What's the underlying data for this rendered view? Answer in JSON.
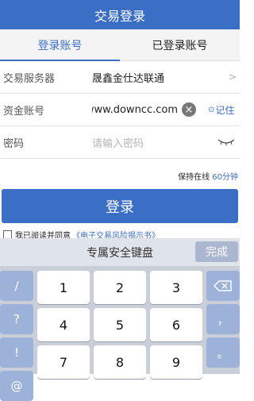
{
  "header": {
    "title": "交易登录"
  },
  "tabs": [
    {
      "label": "登录账号",
      "active": true
    },
    {
      "label": "已登录账号",
      "active": false
    }
  ],
  "server_row": {
    "label": "交易服务器",
    "value": "晟鑫金仕达联通"
  },
  "account_row": {
    "label": "资金账号",
    "value": "www.downcc.com",
    "remember_label": "记住"
  },
  "password_row": {
    "label": "密码",
    "placeholder": "请输入密码"
  },
  "online": {
    "prefix": "保持在线",
    "value": "60分钟"
  },
  "login_button": {
    "label": "登录"
  },
  "agreement": {
    "text": "我已阅读并同意",
    "doc": "《电子交易风险揭示书》"
  },
  "keyboard": {
    "title": "专属安全键盘",
    "done_label": "完成",
    "left_keys": [
      "/",
      "?",
      "!",
      "@"
    ],
    "digits": [
      "1",
      "2",
      "3",
      "4",
      "5",
      "6",
      "7",
      "8",
      "9"
    ],
    "right_keys": [
      "，",
      "。"
    ]
  },
  "colors": {
    "accent": "#3b6fc6",
    "keyboard_bg": "#c9ced8"
  }
}
